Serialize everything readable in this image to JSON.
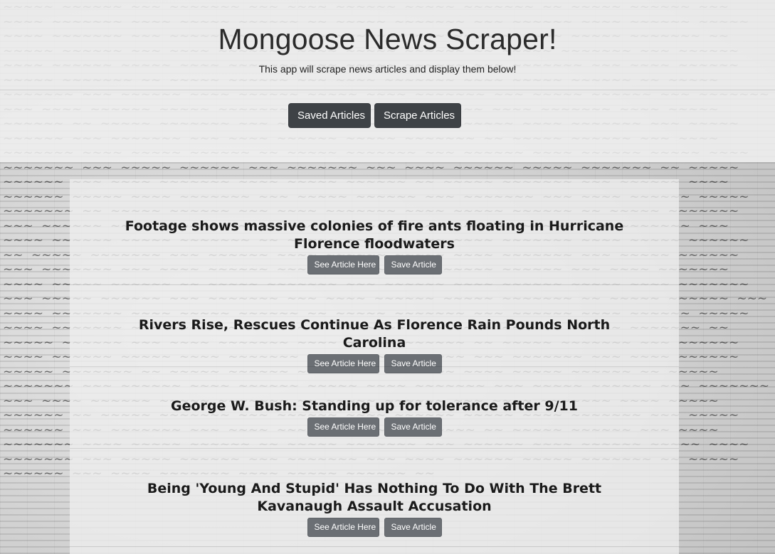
{
  "header": {
    "title": "Mongoose News Scraper!",
    "subtitle": "This app will scrape news articles and display them below!"
  },
  "nav": {
    "saved_label": "Saved Articles",
    "scrape_label": "Scrape Articles"
  },
  "articles": [
    {
      "title": "Footage shows massive colonies of fire ants floating in Hurricane Florence floodwaters",
      "see_label": "See Article Here",
      "save_label": "Save Article"
    },
    {
      "title": "Rivers Rise, Rescues Continue As Florence Rain Pounds North Carolina",
      "see_label": "See Article Here",
      "save_label": "Save Article"
    },
    {
      "title": "George W. Bush: Standing up for tolerance after 9/11",
      "see_label": "See Article Here",
      "save_label": "Save Article"
    },
    {
      "title": "Being 'Young And Stupid' Has Nothing To Do With The Brett Kavanaugh Assault Accusation",
      "see_label": "See Article Here",
      "save_label": "Save Article"
    }
  ],
  "colors": {
    "button_dark": "#3e4246",
    "button_small": "#6b6f74",
    "jumbotron_bg": "#f0f0f0",
    "panel_bg": "#eeeeee"
  }
}
